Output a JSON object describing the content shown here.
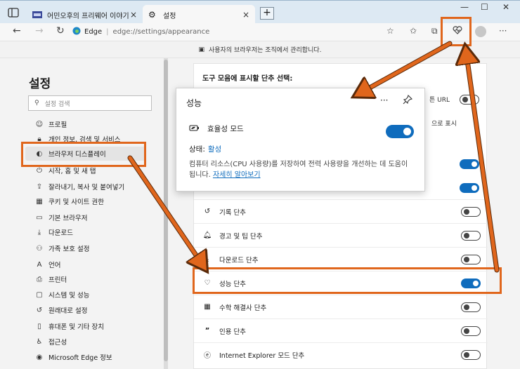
{
  "tabs": [
    {
      "title": "어민오후의 프리웨어 이야기",
      "close": "×",
      "active": false
    },
    {
      "title": "설정",
      "close": "×",
      "active": true
    }
  ],
  "new_tab": "+",
  "window_controls": {
    "minimize": "—",
    "maximize": "☐",
    "close": "✕"
  },
  "address": {
    "site": "Edge",
    "url": "edge://settings/appearance"
  },
  "managed_banner": "사용자의 브라우저는 조직에서 관리합니다.",
  "sidebar": {
    "title": "설정",
    "search_placeholder": "설정 검색",
    "items": [
      {
        "label": "프로필",
        "icon": "person-icon"
      },
      {
        "label": "개인 정보, 검색 및 서비스",
        "icon": "lock-icon"
      },
      {
        "label": "브라우저 디스플레이",
        "icon": "palette-icon",
        "selected": true
      },
      {
        "label": "시작, 홈 및 새 탭",
        "icon": "power-icon"
      },
      {
        "label": "잘라내기, 복사 및 붙여넣기",
        "icon": "share-icon"
      },
      {
        "label": "쿠키 및 사이트 권한",
        "icon": "cookie-icon"
      },
      {
        "label": "기본 브라우저",
        "icon": "browser-icon"
      },
      {
        "label": "다운로드",
        "icon": "download-icon"
      },
      {
        "label": "가족 보호 설정",
        "icon": "family-icon"
      },
      {
        "label": "언어",
        "icon": "language-icon"
      },
      {
        "label": "프린터",
        "icon": "printer-icon"
      },
      {
        "label": "시스템 및 성능",
        "icon": "system-icon"
      },
      {
        "label": "원래대로 설정",
        "icon": "reset-icon"
      },
      {
        "label": "휴대폰 및 기타 장치",
        "icon": "phone-icon"
      },
      {
        "label": "접근성",
        "icon": "accessibility-icon"
      },
      {
        "label": "Microsoft Edge 정보",
        "icon": "edge-icon"
      }
    ]
  },
  "main": {
    "section_heading": "도구 모음에 표시할 단추 선택:",
    "fragments": {
      "url_text": "튼 URL",
      "dropdown_text": "으로 표시"
    },
    "rows": [
      {
        "label": "기록 단추",
        "icon": "history-icon",
        "on": false
      },
      {
        "label": "경고 및 팁 단추",
        "icon": "bell-icon",
        "on": false
      },
      {
        "label": "다운로드 단추",
        "icon": "download-icon",
        "on": false
      },
      {
        "label": "성능 단추",
        "icon": "heartbeat-icon",
        "on": true
      },
      {
        "label": "수학 해결사 단추",
        "icon": "math-icon",
        "on": false
      },
      {
        "label": "인용 단추",
        "icon": "quote-icon",
        "on": false
      },
      {
        "label": "Internet Explorer 모드 단추",
        "icon": "ie-icon",
        "on": false
      }
    ]
  },
  "popup": {
    "title": "성능",
    "more": "···",
    "mode_label": "효율성 모드",
    "mode_on": true,
    "status_label": "상태:",
    "status_value": "활성",
    "description": "컴퓨터 리소스(CPU 사용량)를 저장하여 전력 사용량을 개선하는 데 도움이 됩니다.",
    "learn_more": "자세히 알아보기"
  },
  "colors": {
    "accent": "#0f6cbd",
    "annotation": "#e0661c"
  }
}
